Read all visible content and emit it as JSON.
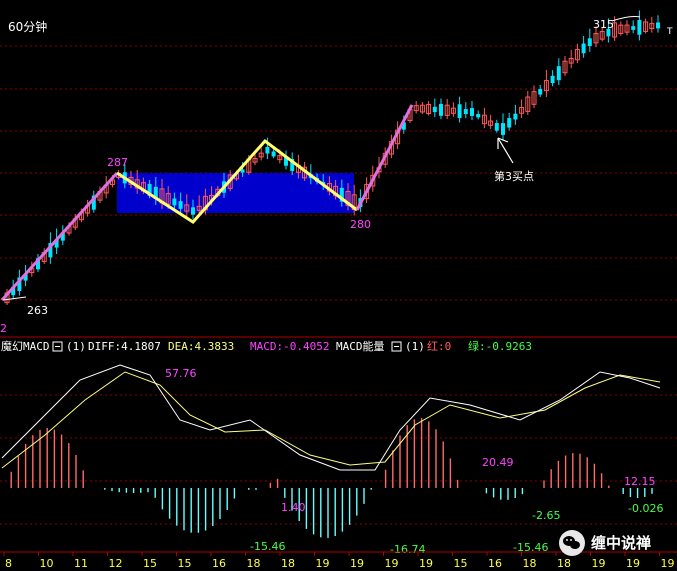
{
  "colors": {
    "background": "#000000",
    "grid": "#8b0000",
    "up": "#ff5a5a",
    "down": "#00e5ff",
    "box": "#0000d8",
    "zigzag_pink": "#e070e0",
    "zigzag_yellow": "#ffff70",
    "diff": "#ffffff",
    "dea": "#ffff80",
    "macd_pos": "#ff6a6a",
    "macd_neg": "#66ffff",
    "label_magenta": "#ff44ff",
    "label_green": "#44ff44"
  },
  "header": {
    "period": "60分钟"
  },
  "price_chart": {
    "annotations": {
      "low_left": "263",
      "peak_left": "287",
      "low_box": "280",
      "high_right": "315",
      "corner_left": "2",
      "corner_right": "T",
      "buy_point": "第3买点"
    },
    "buy_arrow_icon": "arrow-up-left-icon"
  },
  "indicator_bar": {
    "name": "魔幻MACD",
    "param1": "(1)",
    "diff": "DIFF:4.1807",
    "dea": "DEA:4.3833",
    "macd": "MACD:-0.4052",
    "energy_name": "MACD能量",
    "param2": "(1)",
    "red": "红:0",
    "green": "绿:-0.9263"
  },
  "macd_labels": {
    "l1": "57.76",
    "l2": "1.40",
    "l3": "-15.46",
    "l4": "-16.74",
    "l5": "20.49",
    "l6": "-2.65",
    "l7": "-15.46",
    "l8": "12.15",
    "l9": "-0.026"
  },
  "x_axis": {
    "ticks": [
      "8",
      "10",
      "11",
      "12",
      "15",
      "15",
      "16",
      "18",
      "18",
      "19",
      "19",
      "19",
      "19",
      "15",
      "16",
      "18",
      "18",
      "19",
      "19",
      "19"
    ]
  },
  "watermark": {
    "text": "缠中说禅",
    "icon": "wechat-icon"
  },
  "chart_data": {
    "type": "candlestick",
    "price_annotations": [
      263,
      287,
      280,
      315
    ],
    "indicator": "MACD",
    "macd_peak_labels": [
      57.76,
      1.4,
      -15.46,
      -16.74,
      20.49,
      -2.65,
      -15.46,
      12.15,
      -0.026
    ]
  }
}
